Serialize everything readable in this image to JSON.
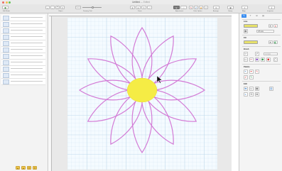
{
  "window": {
    "title": "Untitled",
    "subtitle": "— Edited"
  },
  "toolbar": {
    "groups": [
      {
        "label": "Edit Mode"
      },
      {
        "label": "Object"
      },
      {
        "label": "Drawing Tool"
      },
      {
        "label": "Zoom"
      },
      {
        "label": "Adjustment"
      },
      {
        "label": "Color Option"
      },
      {
        "label": "Arrange"
      },
      {
        "label": "Group"
      },
      {
        "label": "Align"
      },
      {
        "label": "Inspector"
      }
    ],
    "zoom_value": "100%"
  },
  "left_panel": {
    "rows": 11
  },
  "inspector": {
    "line_title": "Line",
    "line_color": "#e7e16a",
    "line_width_value": "0.5 mm",
    "fill_title": "Fill",
    "fill_color": "#e7e16a",
    "brush_title": "Brush",
    "brush_value": "1.0 mm",
    "palette_title": "Palette",
    "edit_title": "Edit"
  },
  "canvas": {
    "flower": {
      "petal_count": 12,
      "petal_color": "#d37bd6",
      "center_color": "#f5ec45"
    },
    "grid_color": "#b9d6ea",
    "page_color": "#f5fbff"
  }
}
